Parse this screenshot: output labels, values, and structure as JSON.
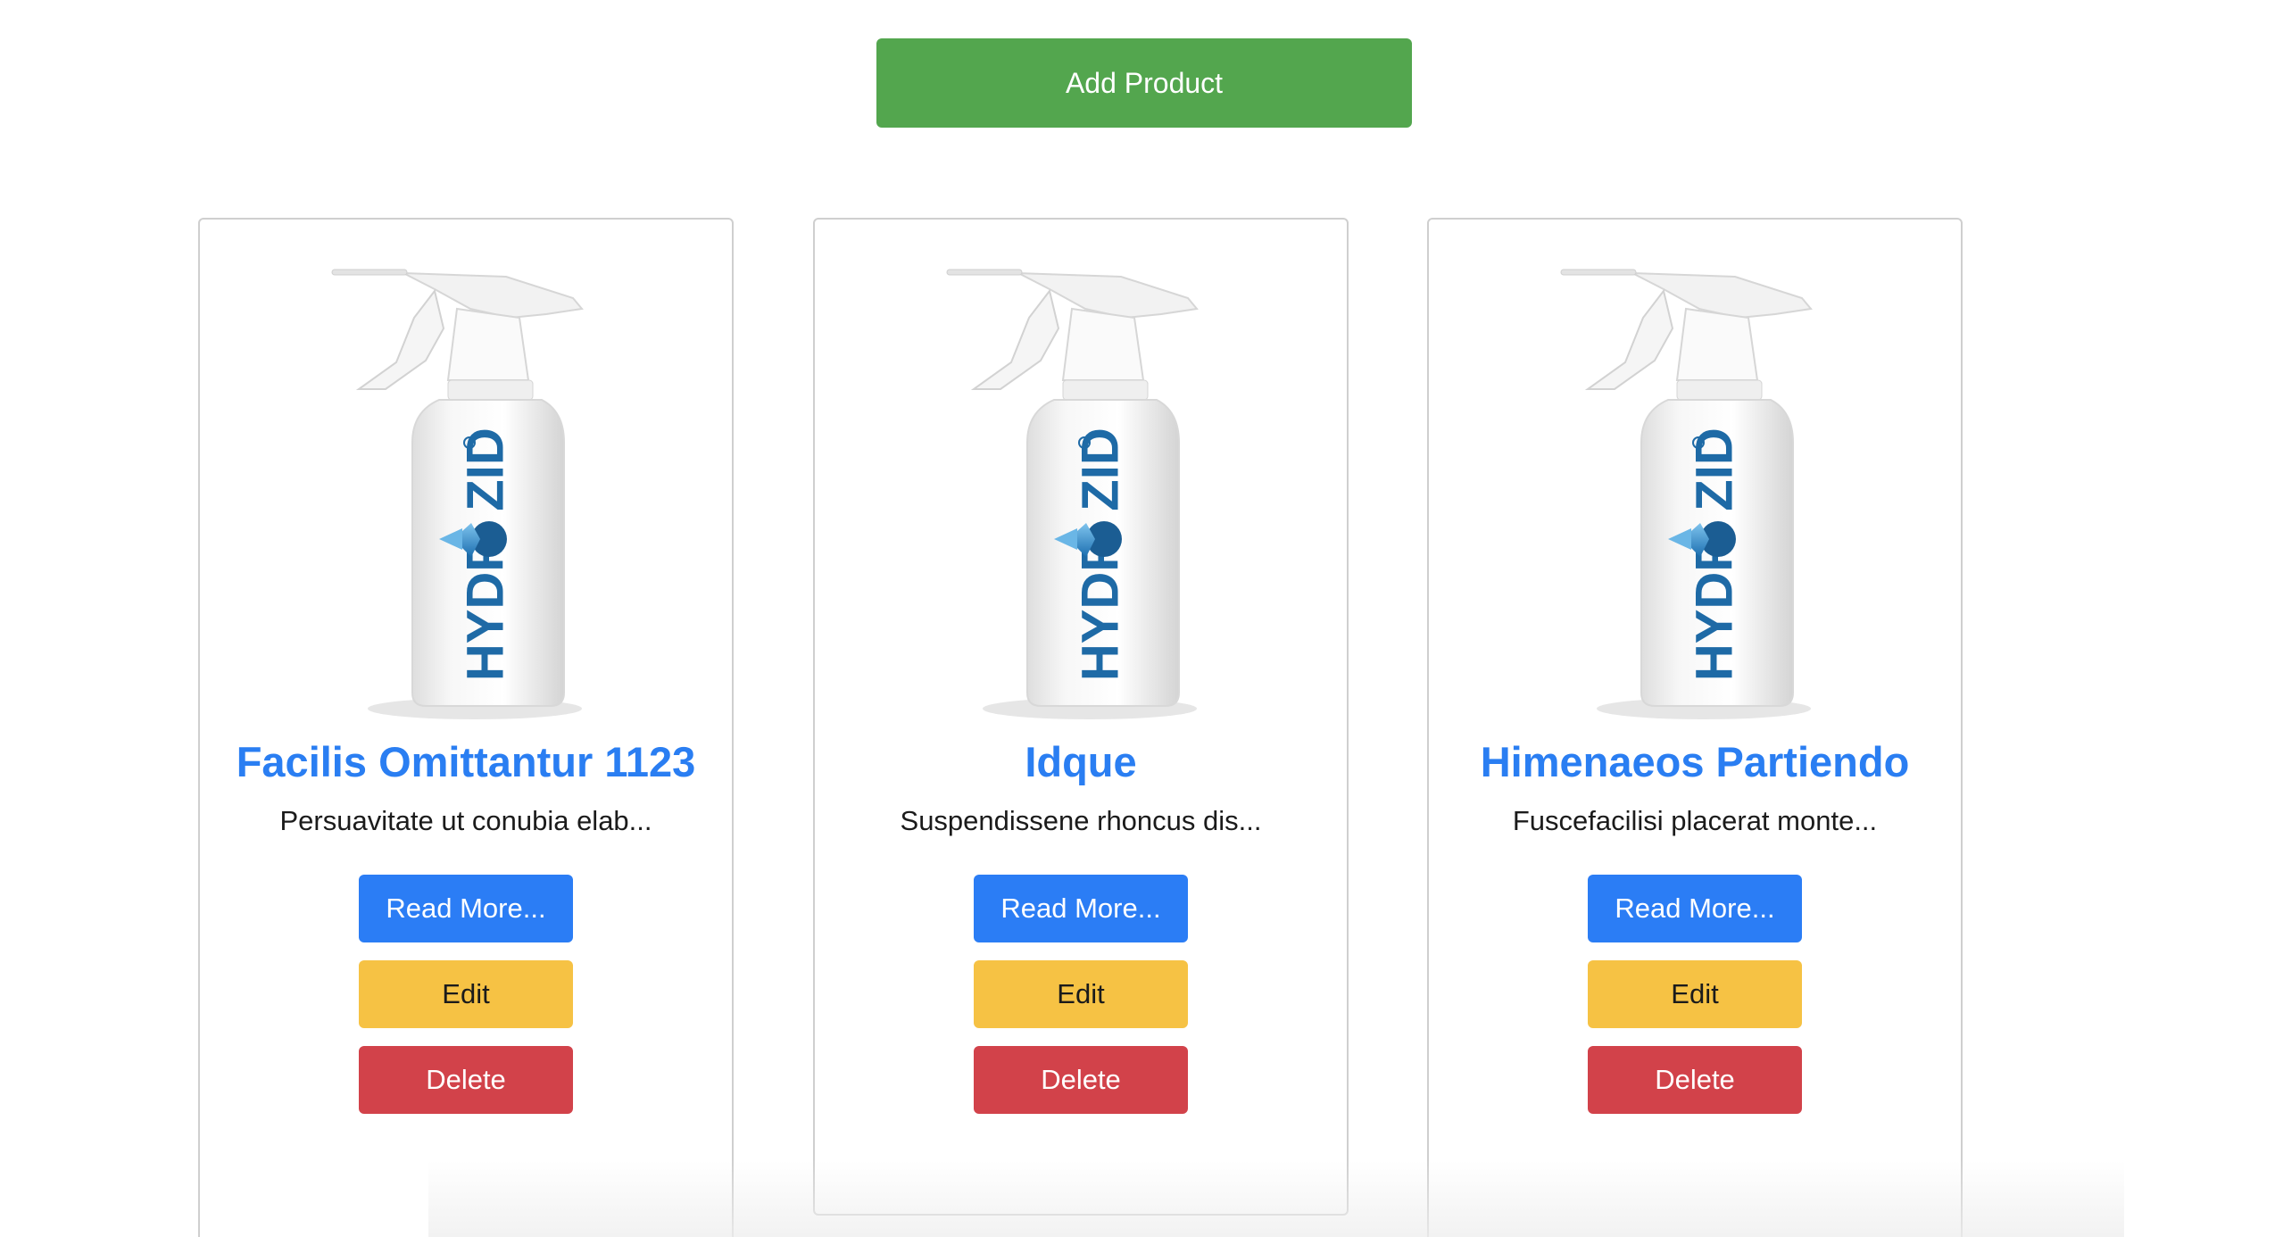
{
  "toolbar": {
    "add_product_label": "Add Product"
  },
  "products": [
    {
      "title": "Facilis Omittantur 1123",
      "description": "Persuavitate ut conubia elab...",
      "brand_logo_text": "HYDROZID",
      "read_more_label": "Read More...",
      "edit_label": "Edit",
      "delete_label": "Delete"
    },
    {
      "title": "Idque",
      "description": "Suspendissene rhoncus dis...",
      "brand_logo_text": "HYDROZID",
      "read_more_label": "Read More...",
      "edit_label": "Edit",
      "delete_label": "Delete"
    },
    {
      "title": "Himenaeos Partiendo",
      "description": "Fuscefacilisi placerat monte...",
      "brand_logo_text": "HYDROZID",
      "read_more_label": "Read More...",
      "edit_label": "Edit",
      "delete_label": "Delete"
    }
  ],
  "colors": {
    "add_button": "#53a64e",
    "title": "#2a7ef2",
    "read_more_button": "#2b7df5",
    "edit_button": "#f6c244",
    "delete_button": "#d2424a",
    "card_border": "#cfcfcf"
  }
}
